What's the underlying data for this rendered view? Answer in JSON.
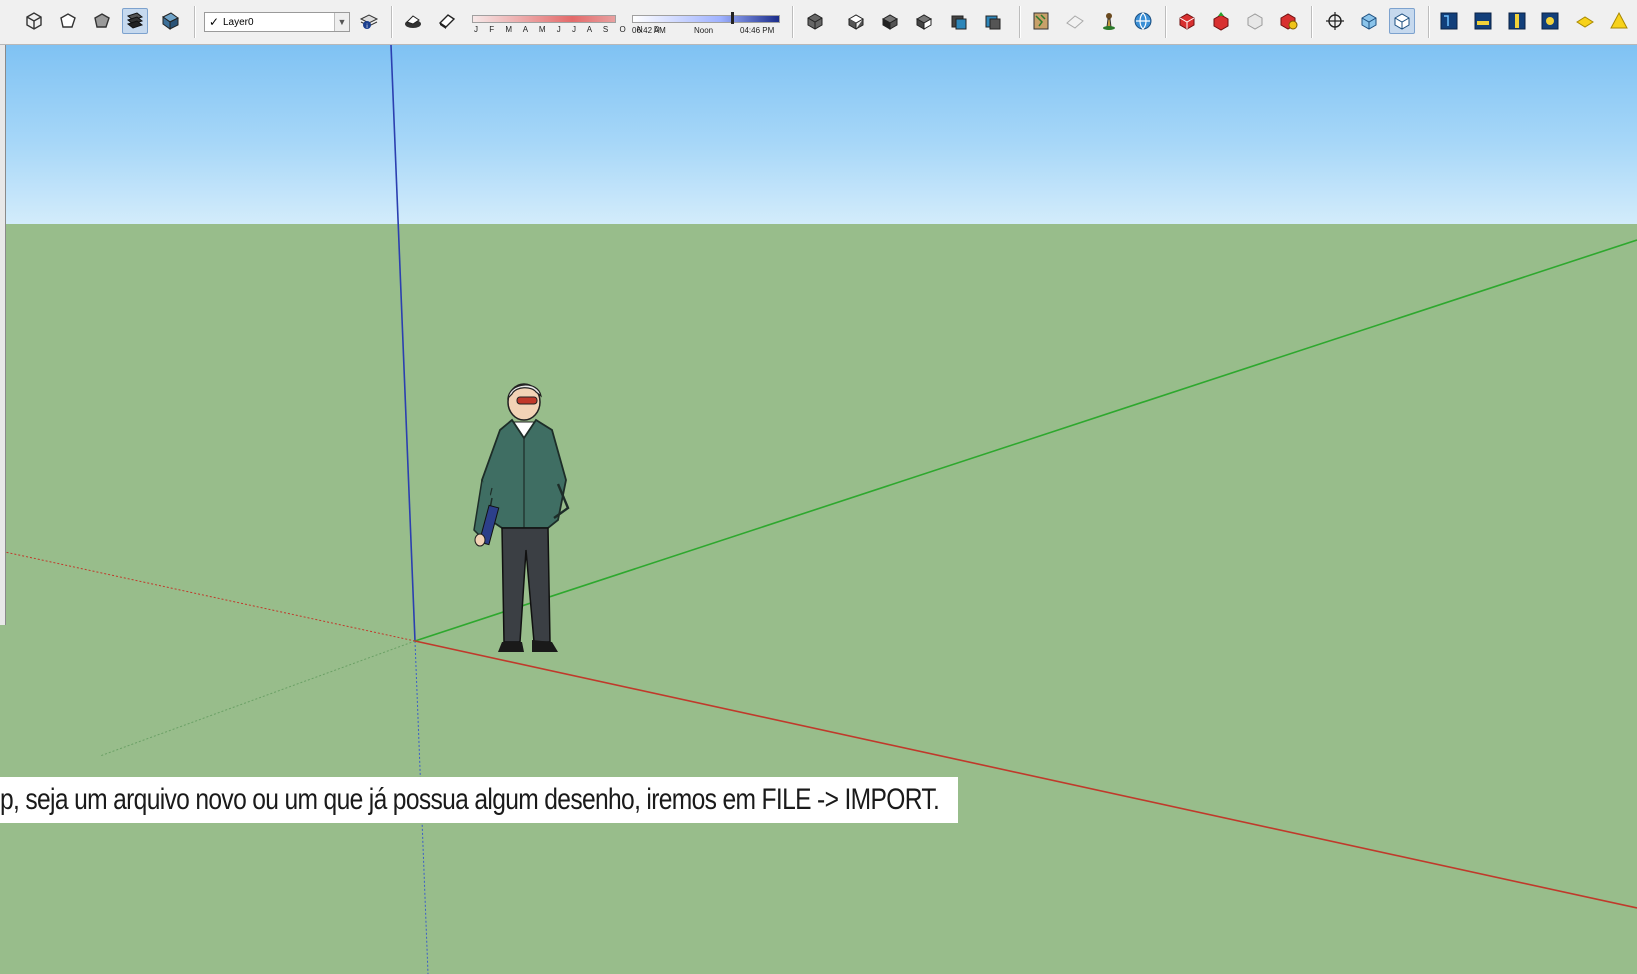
{
  "toolbar": {
    "layer": {
      "checked": true,
      "value": "Layer0"
    },
    "shadow_settings": {
      "months": "J F M A M J J A S O N D",
      "time_start": "06:42 AM",
      "time_noon": "Noon",
      "time_end": "04:46 PM"
    },
    "active_tools": [
      "camera-orbit-tool",
      "shaded-with-textures-style"
    ],
    "icons": [
      "xray-style-icon",
      "wireframe-style-icon",
      "hidden-line-style-icon",
      "shaded-style-icon",
      "shaded-with-textures-style-icon",
      "layer-manager-icon",
      "display-shadows-icon",
      "display-fog-icon",
      "iso-view-icon",
      "top-view-icon",
      "front-view-icon",
      "right-view-icon",
      "back-view-icon",
      "left-view-icon",
      "add-location-icon",
      "toggle-terrain-icon",
      "place-model-icon",
      "get-models-icon",
      "get-models-icon",
      "share-model-icon",
      "share-component-icon",
      "extension-warehouse-icon",
      "position-camera-icon",
      "walk-icon",
      "orbit-icon",
      "section-plane-icon",
      "display-section-cuts-icon",
      "display-section-planes-icon",
      "ruby-console-icon",
      "warning-icon",
      "sun-icon"
    ]
  },
  "scene": {
    "colors": {
      "sky_top": "#7fc2f3",
      "sky_bottom": "#d3ecfb",
      "ground": "#98bd8b",
      "axis_red": "#c0392b",
      "axis_green": "#2ea82e",
      "axis_blue": "#2b3fb0"
    }
  },
  "caption": {
    "text": "p, seja um arquivo novo ou um que já possua algum desenho, iremos em FILE -> IMPORT."
  }
}
